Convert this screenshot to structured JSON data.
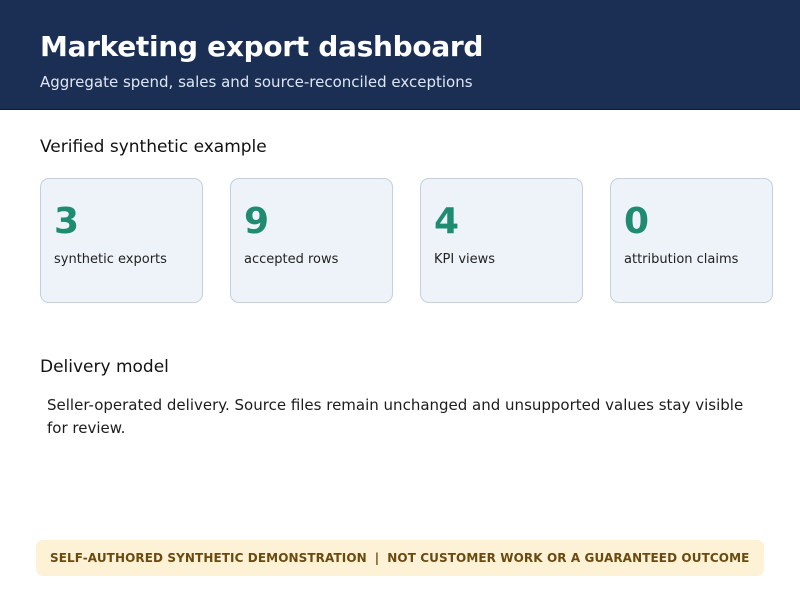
{
  "header": {
    "title": "Marketing export dashboard",
    "subtitle": "Aggregate spend, sales and source-reconciled exceptions"
  },
  "verified_section": {
    "heading": "Verified synthetic example",
    "cards": [
      {
        "value": "3",
        "label": "synthetic exports"
      },
      {
        "value": "9",
        "label": "accepted rows"
      },
      {
        "value": "4",
        "label": "KPI views"
      },
      {
        "value": "0",
        "label": "attribution claims"
      }
    ]
  },
  "delivery_section": {
    "heading": "Delivery model",
    "text": "Seller-operated delivery. Source files remain unchanged and unsupported values stay visible for review."
  },
  "disclaimer": {
    "left": "SELF-AUTHORED SYNTHETIC DEMONSTRATION",
    "separator": "|",
    "right": "NOT CUSTOMER WORK OR A GUARANTEED OUTCOME"
  },
  "colors": {
    "header_bg": "#1b2f55",
    "kpi_value": "#1f8c72",
    "card_bg": "#eef3f9",
    "disclaimer_bg": "#fdf2d6",
    "disclaimer_text": "#6b4a10"
  }
}
